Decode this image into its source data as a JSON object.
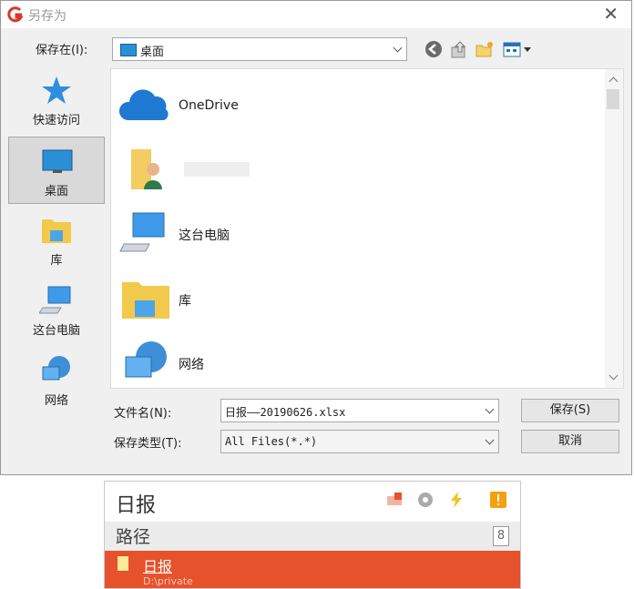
{
  "window": {
    "title": "另存为"
  },
  "save_in": {
    "label": "保存在(I):",
    "value": "桌面"
  },
  "toolbar": {
    "icons": [
      "back-icon",
      "up-folder-icon",
      "new-folder-icon",
      "view-menu-icon"
    ]
  },
  "places": [
    {
      "label": "快速访问",
      "icon": "star-icon"
    },
    {
      "label": "桌面",
      "icon": "desktop-icon",
      "selected": true
    },
    {
      "label": "库",
      "icon": "library-icon"
    },
    {
      "label": "这台电脑",
      "icon": "computer-icon"
    },
    {
      "label": "网络",
      "icon": "network-icon"
    }
  ],
  "files": [
    {
      "label": "OneDrive",
      "icon": "cloud-icon"
    },
    {
      "label": "",
      "icon": "user-folder-icon"
    },
    {
      "label": "这台电脑",
      "icon": "computer-icon"
    },
    {
      "label": "库",
      "icon": "library-icon"
    },
    {
      "label": "网络",
      "icon": "network-icon"
    }
  ],
  "filename": {
    "label": "文件名(N):",
    "value": "日报——20190626.xlsx"
  },
  "filetype": {
    "label": "保存类型(T):",
    "value": "All Files(*.*)"
  },
  "buttons": {
    "save": "保存(S)",
    "cancel": "取消"
  },
  "popup": {
    "title": "日报",
    "section": "路径",
    "badge": "8",
    "item": {
      "name": "日报",
      "path": "D:\\private"
    }
  },
  "colors": {
    "accent": "#e6522c",
    "selected_bg": "#d9d9d9"
  }
}
